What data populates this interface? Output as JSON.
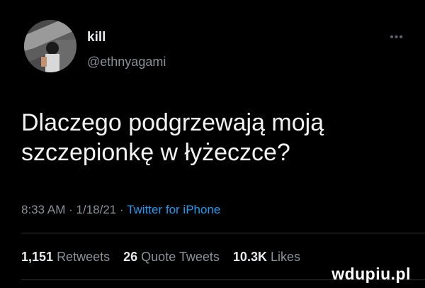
{
  "user": {
    "display_name": "kill",
    "handle": "@ethnyagami"
  },
  "more_icon": "more-icon",
  "tweet": {
    "text": "Dlaczego podgrzewają moją szczepionkę w łyżeczce?"
  },
  "meta": {
    "time": "8:33 AM",
    "separator": "·",
    "date": "1/18/21",
    "source": "Twitter for iPhone"
  },
  "stats": {
    "retweets_count": "1,151",
    "retweets_label": "Retweets",
    "quote_count": "26",
    "quote_label": "Quote Tweets",
    "likes_count": "10.3K",
    "likes_label": "Likes"
  },
  "watermark": "wdupiu.pl",
  "colors": {
    "background": "#000000",
    "link": "#1d9bf0",
    "secondary_text": "#8b9198"
  }
}
